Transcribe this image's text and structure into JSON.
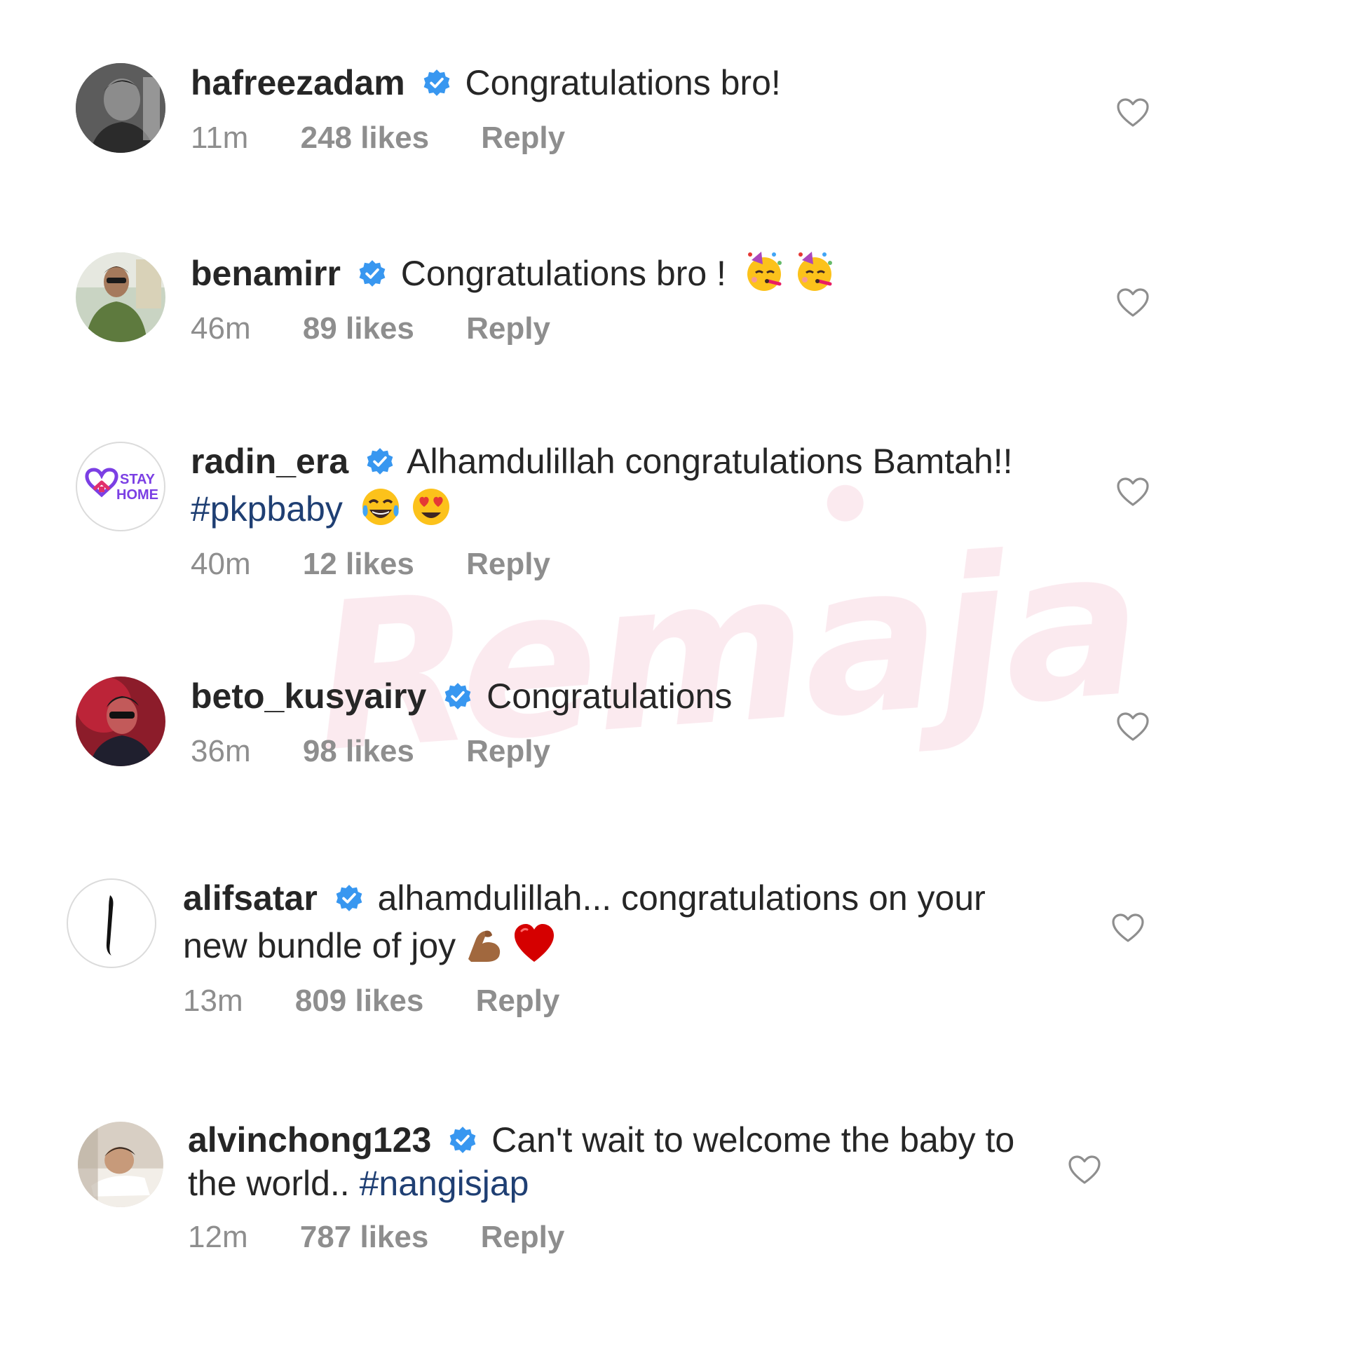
{
  "watermark": "Remaja",
  "colors": {
    "verified_badge": "#3897f0",
    "hashtag": "#1f3f73",
    "meta_text": "#8e8e8e",
    "heart_outline": "#8e8e8e",
    "watermark": "#f8d8e2"
  },
  "comments": [
    {
      "username": "hafreezadam",
      "text": "Congratulations bro!",
      "time": "11m",
      "likes": "248 likes",
      "reply": "Reply",
      "avatar_icon": "profile-photo-icon"
    },
    {
      "username": "benamirr",
      "text": "Congratulations bro !",
      "emojis": [
        "partying-face-emoji",
        "partying-face-emoji"
      ],
      "time": "46m",
      "likes": "89 likes",
      "reply": "Reply",
      "avatar_icon": "profile-photo-icon"
    },
    {
      "username": "radin_era",
      "text": "Alhamdulillah congratulations Bamtah!!",
      "hashtag": "#pkpbaby",
      "emojis": [
        "tears-of-joy-emoji",
        "heart-eyes-emoji"
      ],
      "time": "40m",
      "likes": "12 likes",
      "reply": "Reply",
      "avatar_line1": "STAY",
      "avatar_line2": "HOME"
    },
    {
      "username": "beto_kusyairy",
      "text": "Congratulations",
      "time": "36m",
      "likes": "98 likes",
      "reply": "Reply",
      "avatar_icon": "profile-photo-icon"
    },
    {
      "username": "alifsatar",
      "text": "alhamdulillah... congratulations on your new bundle of joy",
      "emojis": [
        "flexed-biceps-emoji",
        "red-heart-emoji"
      ],
      "time": "13m",
      "likes": "809 likes",
      "reply": "Reply",
      "avatar_icon": "calligraphy-logo-icon"
    },
    {
      "username": "alvinchong123",
      "text": "Can't wait to welcome the baby to the world..",
      "hashtag": "#nangisjap",
      "time": "12m",
      "likes": "787 likes",
      "reply": "Reply",
      "avatar_icon": "profile-photo-icon"
    }
  ]
}
